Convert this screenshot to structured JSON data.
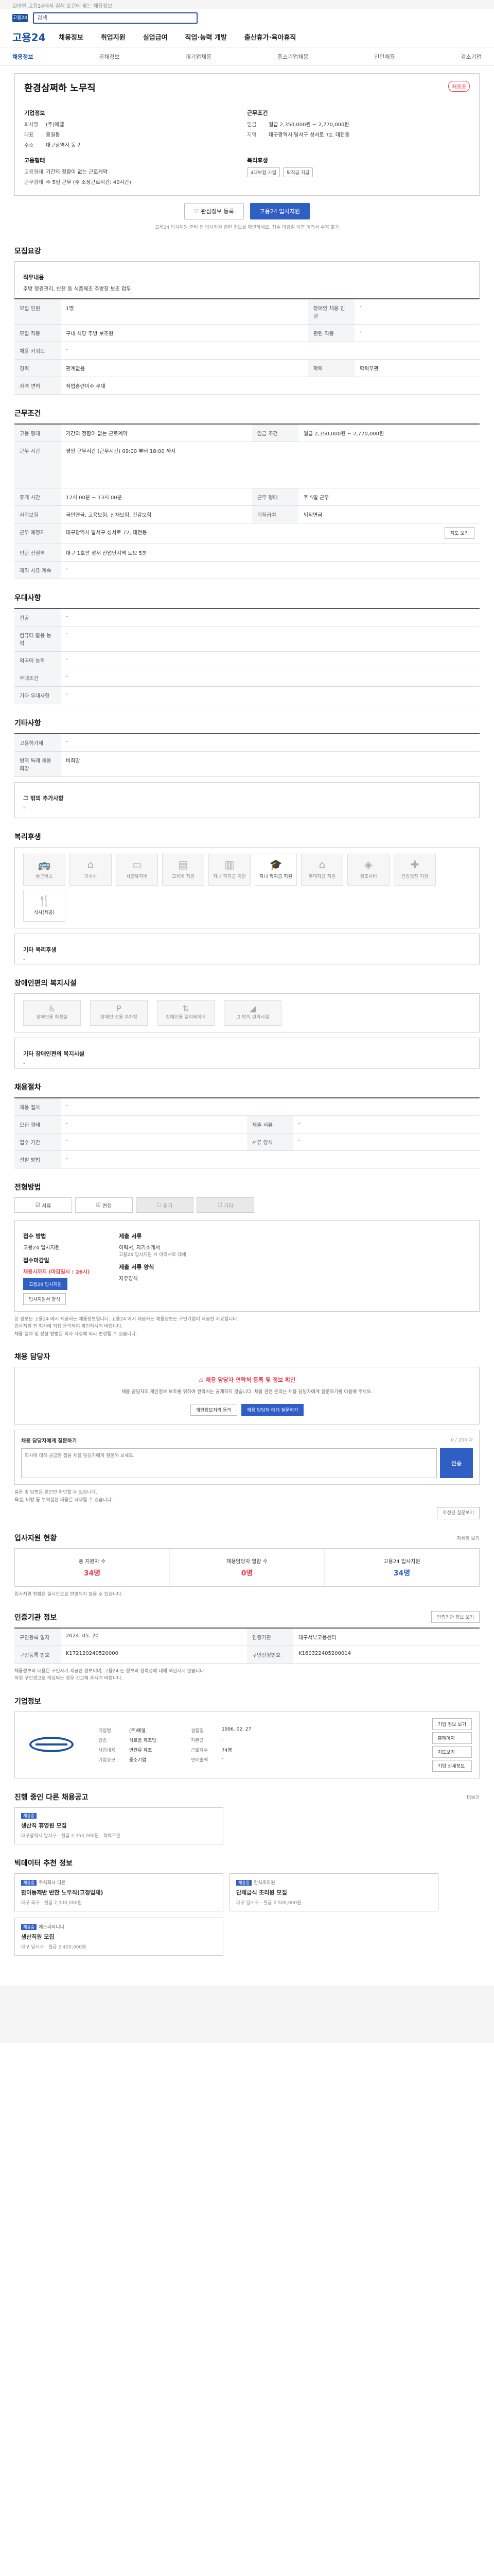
{
  "topbar": {
    "text": "모바일 고용24에서 검색 조건에 맞는 채용정보"
  },
  "header": {
    "logo_text": "고용24",
    "search_placeholder": "검색"
  },
  "nav": {
    "brand": "고용24",
    "items": [
      "채용정보",
      "취업지원",
      "실업급여",
      "직업·능력 개발",
      "출산휴가·육아휴직"
    ]
  },
  "subnav": {
    "items": [
      "채용정보",
      "공채정보",
      "대기업채용",
      "중소기업채용",
      "인턴채용",
      "강소기업"
    ]
  },
  "job": {
    "title": "환경삼쩌하 노무직",
    "status": "채용중",
    "company_label": "기업정보",
    "company_kv": [
      {
        "k": "회사명",
        "v": "(주)에델",
        "bind": "company_name"
      },
      {
        "k": "대표",
        "v": "홍길동"
      },
      {
        "k": "주소",
        "v": "대구광역시 동구"
      }
    ],
    "work_label": "근무조건",
    "work_kv": [
      {
        "k": "임금",
        "v": "월급 2,350,000원 ~ 2,770,000원"
      },
      {
        "k": "지역",
        "v": "대구광역시 달서구 성서로 72, 대전동"
      }
    ],
    "type_label": "고용형태",
    "type_kv": [
      {
        "k": "고용형태",
        "v": "기간의 정함이 없는 근로계약"
      },
      {
        "k": "근무형태",
        "v": "주 5일 근무 (주 소정근로시간: 40시간)"
      }
    ],
    "welfare_label": "복리후생",
    "welfare_chips": [
      "4대보험 가입",
      "퇴직금 지급"
    ],
    "btn_scrap": "관심정보 등록",
    "btn_apply": "고용24 입사지원",
    "notice": "고용24 입사지원 준비 전 입사지원 관련 정보를 확인하세요. 접수 마감일 이후 이력서 수정 불가"
  },
  "recruit": {
    "section": "모집요강",
    "duty_label": "직무내용",
    "duty": "주방 청결관리, 반찬 등 식품제조 주방장 보조 업무",
    "rows": [
      {
        "k": "모집 인원",
        "v": "1명",
        "k2": "장애인 채용 인원",
        "v2": "-"
      },
      {
        "k": "모집 직종",
        "v": "구내 식당 주방 보조원",
        "k2": "관련 직종",
        "v2": "-"
      },
      {
        "k": "채용 키워드",
        "v": "-",
        "k2": "",
        "v2": ""
      },
      {
        "k": "경력",
        "v": "관계없음",
        "k2": "학력",
        "v2": "학력무관"
      },
      {
        "k": "자격 면허",
        "v": "직업훈련이수 우대",
        "k2": "",
        "v2": ""
      }
    ]
  },
  "conditions": {
    "section": "근무조건",
    "rows": [
      {
        "k": "고용 형태",
        "v": "기간의 정함이 없는 근로계약",
        "k2": "임금 조건",
        "v2": "월급 2,350,000원 ~ 2,770,000원"
      },
      {
        "k": "근무 시간",
        "v": "평일 근무시간 (근무시간) 09:00 부터 18:00 까지",
        "k2": "",
        "v2": ""
      },
      {
        "k": "휴게 시간",
        "v": "12시 00분 ~ 13시 00분",
        "k2": "근무 형태",
        "v2": "주 5일 근무"
      },
      {
        "k": "사회보험",
        "v": "국민연금, 고용보험, 산재보험, 건강보험",
        "k2": "퇴직급여",
        "v2": "퇴직연금"
      },
      {
        "k": "근무 예정지",
        "v": "대구광역시 달서구 성서로 72, 대전동",
        "k2": "",
        "v2": ""
      },
      {
        "k": "인근 전철역",
        "v": "대구 1호선 성서 산업단지역 도보 5분",
        "k2": "",
        "v2": ""
      },
      {
        "k": "재직 사유 계속",
        "v": "-",
        "k2": "",
        "v2": ""
      }
    ],
    "map_btn": "지도 보기"
  },
  "preference": {
    "section": "우대사항",
    "rows": [
      {
        "k": "전공",
        "v": "-"
      },
      {
        "k": "컴퓨터 활용 능력",
        "v": "-"
      },
      {
        "k": "외국어 능력",
        "v": "-"
      },
      {
        "k": "우대조건",
        "v": "-"
      },
      {
        "k": "기타 우대사항",
        "v": "-"
      }
    ]
  },
  "other": {
    "section": "기타사항",
    "rows": [
      {
        "k": "고용허가제",
        "v": "-"
      },
      {
        "k": "병역 특례 채용 희망",
        "v": "비희망"
      }
    ],
    "extra_label": "그 밖의 추가사항",
    "extra_value": "-"
  },
  "welfare": {
    "section": "복리후생",
    "items": [
      {
        "label": "통근버스",
        "icon": "bus-icon",
        "on": false
      },
      {
        "label": "기숙사",
        "icon": "house-icon",
        "on": false
      },
      {
        "label": "차량유지비",
        "icon": "car-icon",
        "on": false
      },
      {
        "label": "교육비 지원",
        "icon": "book-icon",
        "on": false
      },
      {
        "label": "자녀 학자금 지원",
        "icon": "grad-icon",
        "on": true
      },
      {
        "label": "주택자금 지원",
        "icon": "home-icon",
        "on": false
      },
      {
        "label": "경조사비",
        "icon": "gift-icon",
        "on": false
      },
      {
        "label": "건강검진 지원",
        "icon": "health-icon",
        "on": false
      },
      {
        "label": "식사(제공)",
        "icon": "meal-icon",
        "on": true
      }
    ],
    "other_label": "기타 복리후생",
    "other_value": "-"
  },
  "disabled": {
    "section": "장애인편의 복지시설",
    "items": [
      "장애인용 화장실",
      "장애인 전용 주차장",
      "장애인용 엘리베이터",
      "그 밖의 편의시설"
    ],
    "other_label": "기타 장애인편의 복지시설",
    "other_value": "-"
  },
  "process": {
    "section": "채용절차",
    "rows": [
      {
        "k": "채용 절차",
        "v": "-",
        "k2": "",
        "v2": ""
      },
      {
        "k": "모집 형태",
        "v": "-",
        "k2": "제출 서류",
        "v2": "-"
      },
      {
        "k": "접수 기간",
        "v": "-",
        "k2": "서류 양식",
        "v2": "-"
      },
      {
        "k": "선발 방법",
        "v": "-",
        "k2": "",
        "v2": ""
      }
    ]
  },
  "method": {
    "section": "전형방법",
    "items": [
      {
        "label": "서류",
        "off": false
      },
      {
        "label": "면접",
        "off": false
      },
      {
        "label": "필기",
        "off": true
      },
      {
        "label": "기타",
        "off": true
      }
    ],
    "apply_label": "접수 방법",
    "apply_value": "고용24 입사지원",
    "deadline_label": "접수마감일",
    "deadline_value": "채용시까지 (마감일시 : 26시)",
    "btn_apply": "고용24 입사지원",
    "btn_form": "입사지원서 양식",
    "docs_label": "제출 서류",
    "docs_value": "이력서, 자기소개서",
    "docs_sub": "고용24 입사지원 시 이력서로 대체",
    "form_label": "제출 서류 양식",
    "form_value": "자유양식",
    "bullets": [
      "본 정보는 고용24 에서 제공하는 채용정보입니다. 고용24 에서 제공하는 채용정보는 구인기업이 제공한 자료입니다.",
      "입사지원 전 회사에 직접 문의하여 확인하시기 바랍니다.",
      "채용 절차 및 전형 방법은 회사 사정에 따라 변경될 수 있습니다."
    ]
  },
  "manager": {
    "section": "채용 담당자",
    "warning": "채용 담당자 연락처 등록 및 정보 확인",
    "desc": "채용 담당자의 개인정보 보호를 위하여 연락처는 공개하지 않습니다. 채용 관련 문의는 채용 담당자에게 질문하기를 이용해 주세요.",
    "btn_info": "개인정보처리 동의",
    "btn_ask": "채용 담당자 에게 질문하기",
    "q_title": "채용 담당자에게 질문하기",
    "q_counter": "0 / 200 자",
    "q_placeholder": "회사에 대해 궁금한 점을 채용 담당자에게 질문해 보세요.",
    "q_submit": "전송",
    "q_bullets": [
      "질문 및 답변은 본인만 확인할 수 있습니다.",
      "욕설, 비방 등 부적절한 내용은 삭제될 수 있습니다."
    ],
    "q_more": "작성된 질문보기"
  },
  "stats": {
    "section": "입사지원 현황",
    "more": "자세히 보기",
    "items": [
      {
        "label": "총 지원자 수",
        "value": "34명",
        "blue": false
      },
      {
        "label": "채용담당자 열람 수",
        "value": "0명",
        "blue": false
      },
      {
        "label": "고용24 입사지원",
        "value": "34명",
        "blue": true
      }
    ],
    "note": "입사지원 현황은 실시간으로 반영되지 않을 수 있습니다."
  },
  "auth": {
    "section": "인증기관 정보",
    "btn": "인증기관 정보 보기",
    "rows": [
      {
        "k": "구인등록 일자",
        "v": "2024. 05. 20",
        "k2": "인증기관",
        "v2": "대구서부고용센터"
      },
      {
        "k": "구인등록 번호",
        "v": "K172120240520000",
        "k2": "구인신청번호",
        "v2": "K160322405200014"
      }
    ],
    "bullets": [
      "채용정보의 내용은 구인자가 제공한 정보이며, 고용24 는 정보의 정확성에 대해 책임지지 않습니다.",
      "허위 구인광고로 의심되는 경우 신고해 주시기 바랍니다."
    ]
  },
  "company": {
    "section": "기업정보",
    "rows": [
      {
        "k": "기업명",
        "v": "(주)에델"
      },
      {
        "k": "설립일",
        "v": "1996. 02. 27"
      },
      {
        "k": "업종",
        "v": "식료품 제조업"
      },
      {
        "k": "자본금",
        "v": "-"
      },
      {
        "k": "사업내용",
        "v": "반찬류 제조"
      },
      {
        "k": "근로자수",
        "v": "74명"
      },
      {
        "k": "기업규모",
        "v": "중소기업"
      },
      {
        "k": "연매출액",
        "v": "-"
      }
    ],
    "btn_detail": "기업 정보 보기",
    "btn_hp": "홈페이지",
    "btn_map": "지도보기",
    "btn_more": "기업 상세정보"
  },
  "hiring": {
    "section": "진행 중인 다른 채용공고",
    "more": "더보기",
    "card_tag": "채용중",
    "card_name": "생산직 휴영원 모집",
    "card_meta": "대구광역시 달서구 · 월급 2,350,000원 · 학력무관"
  },
  "recommend": {
    "section": "빅데이터 추천 정보",
    "cards": [
      {
        "tag": "채용중",
        "company": "주식회사 다온",
        "name": "환이동제반 반찬 노무직(고정업체)",
        "meta": "대구 북구 · 월급 2,300,000원"
      },
      {
        "tag": "채용중",
        "company": "한식조리원",
        "name": "단체급식 조리원 모집",
        "meta": "대구 달서구 · 월급 2,500,000원"
      },
      {
        "tag": "채용중",
        "company": "에스피씨디디",
        "name": "생산직원 모집",
        "meta": "대구 달서구 · 월급 2,400,000원"
      }
    ]
  }
}
